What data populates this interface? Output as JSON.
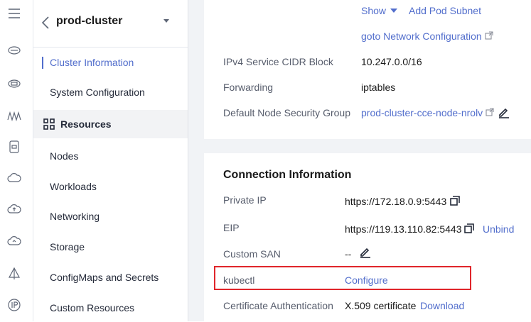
{
  "sidebar": {
    "cluster_name": "prod-cluster",
    "items": [
      {
        "label": "Cluster Information",
        "active": true
      },
      {
        "label": "System Configuration"
      },
      {
        "label": "Resources",
        "group": true
      },
      {
        "label": "Nodes"
      },
      {
        "label": "Workloads"
      },
      {
        "label": "Networking"
      },
      {
        "label": "Storage"
      },
      {
        "label": "ConfigMaps and Secrets"
      },
      {
        "label": "Custom Resources"
      }
    ]
  },
  "network": {
    "show_label": "Show",
    "add_subnet_label": "Add Pod Subnet",
    "goto_network_label": "goto Network Configuration",
    "ipv4_cidr_label": "IPv4 Service CIDR Block",
    "ipv4_cidr_value": "10.247.0.0/16",
    "forwarding_label": "Forwarding",
    "forwarding_value": "iptables",
    "sg_label": "Default Node Security Group",
    "sg_value": "prod-cluster-cce-node-nrolv"
  },
  "connection": {
    "title": "Connection Information",
    "private_ip_label": "Private IP",
    "private_ip_value": "https://172.18.0.9:5443",
    "eip_label": "EIP",
    "eip_value": "https://119.13.110.82:5443",
    "unbind_label": "Unbind",
    "custom_san_label": "Custom SAN",
    "custom_san_value": "--",
    "kubectl_label": "kubectl",
    "kubectl_link": "Configure",
    "cert_label": "Certificate Authentication",
    "cert_value": "X.509 certificate",
    "download_label": "Download"
  },
  "colors": {
    "link": "#526ecc",
    "highlight": "#e0262b",
    "content_bg": "#f1f3f6"
  }
}
